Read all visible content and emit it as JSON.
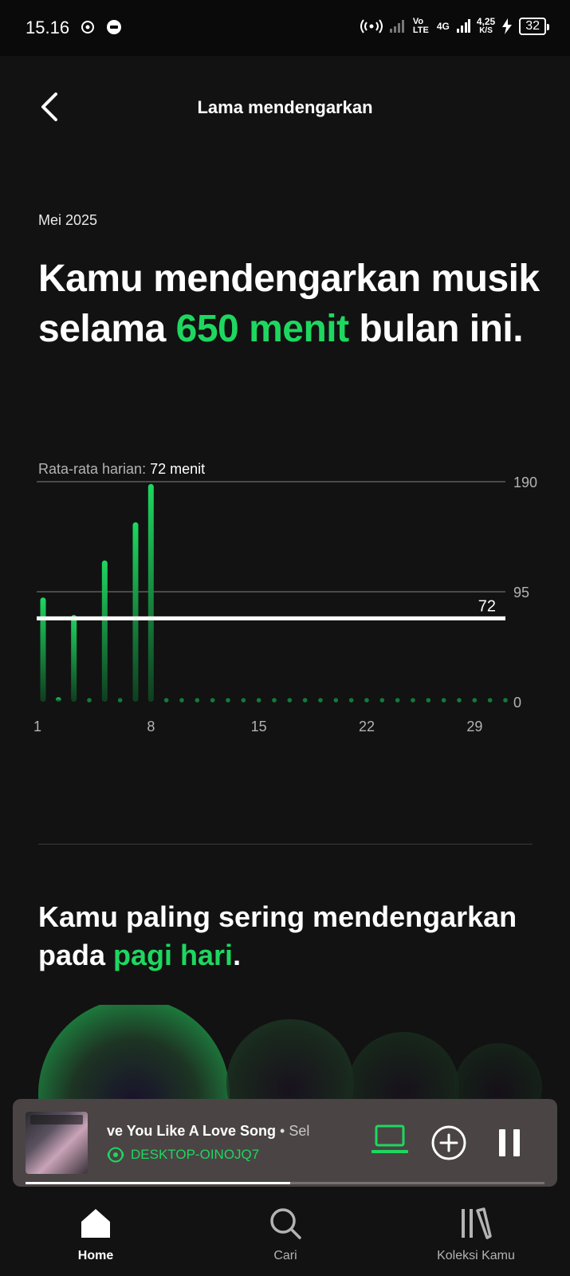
{
  "status_bar": {
    "time": "15.16",
    "network_lte": "Vo LTE",
    "network_4g": "4G",
    "speed_value": "4,25",
    "speed_unit": "K/S",
    "battery": "32",
    "icons": [
      "gallery-icon",
      "chat-icon",
      "hotspot-icon",
      "signal-icon",
      "charging-icon",
      "battery-icon"
    ]
  },
  "header": {
    "title": "Lama mendengarkan",
    "back_icon": "chevron-left-icon"
  },
  "period_label": "Mei 2025",
  "headline": {
    "prefix": "Kamu mendengarkan musik selama ",
    "highlight": "650 menit",
    "suffix": " bulan ini."
  },
  "average": {
    "label": "Rata-rata harian:",
    "value": "72 menit"
  },
  "chart_data": {
    "type": "bar",
    "x": [
      1,
      2,
      3,
      4,
      5,
      6,
      7,
      8,
      9,
      10,
      11,
      12,
      13,
      14,
      15,
      16,
      17,
      18,
      19,
      20,
      21,
      22,
      23,
      24,
      25,
      26,
      27,
      28,
      29,
      30,
      31
    ],
    "values": [
      90,
      4,
      75,
      0,
      122,
      0,
      155,
      188,
      0,
      0,
      0,
      0,
      0,
      0,
      0,
      0,
      0,
      0,
      0,
      0,
      0,
      0,
      0,
      0,
      0,
      0,
      0,
      0,
      0,
      0,
      0
    ],
    "x_ticks": [
      "1",
      "8",
      "15",
      "22",
      "29"
    ],
    "y_ticks": [
      "190",
      "95",
      "0"
    ],
    "ylim": [
      0,
      190
    ],
    "average_line": 72,
    "average_label": "72",
    "grid": true,
    "colors": {
      "bar_top": "#1ed760",
      "bar_bottom": "#0f3d1f",
      "average_line": "#ffffff",
      "grid": "#4a4a4a"
    }
  },
  "time_of_day": {
    "prefix": "Kamu paling sering mendengarkan pada ",
    "highlight": "pagi hari",
    "suffix": "."
  },
  "mini_player": {
    "song_title": "ve You Like A Love Song",
    "separator": " • ",
    "artist": "Sel",
    "device": "DESKTOP-OINOJQ7",
    "progress": 0.51,
    "icons": {
      "device": "laptop-icon",
      "add": "add-circle-icon",
      "pause": "pause-icon",
      "speaker": "speaker-icon"
    }
  },
  "bottom_nav": {
    "items": [
      {
        "label": "Home",
        "icon": "home-icon",
        "active": true
      },
      {
        "label": "Cari",
        "icon": "search-icon",
        "active": false
      },
      {
        "label": "Koleksi Kamu",
        "icon": "library-icon",
        "active": false
      }
    ]
  },
  "colors": {
    "accent": "#1ed760",
    "background": "#121212",
    "player_bg": "#4a4444"
  }
}
